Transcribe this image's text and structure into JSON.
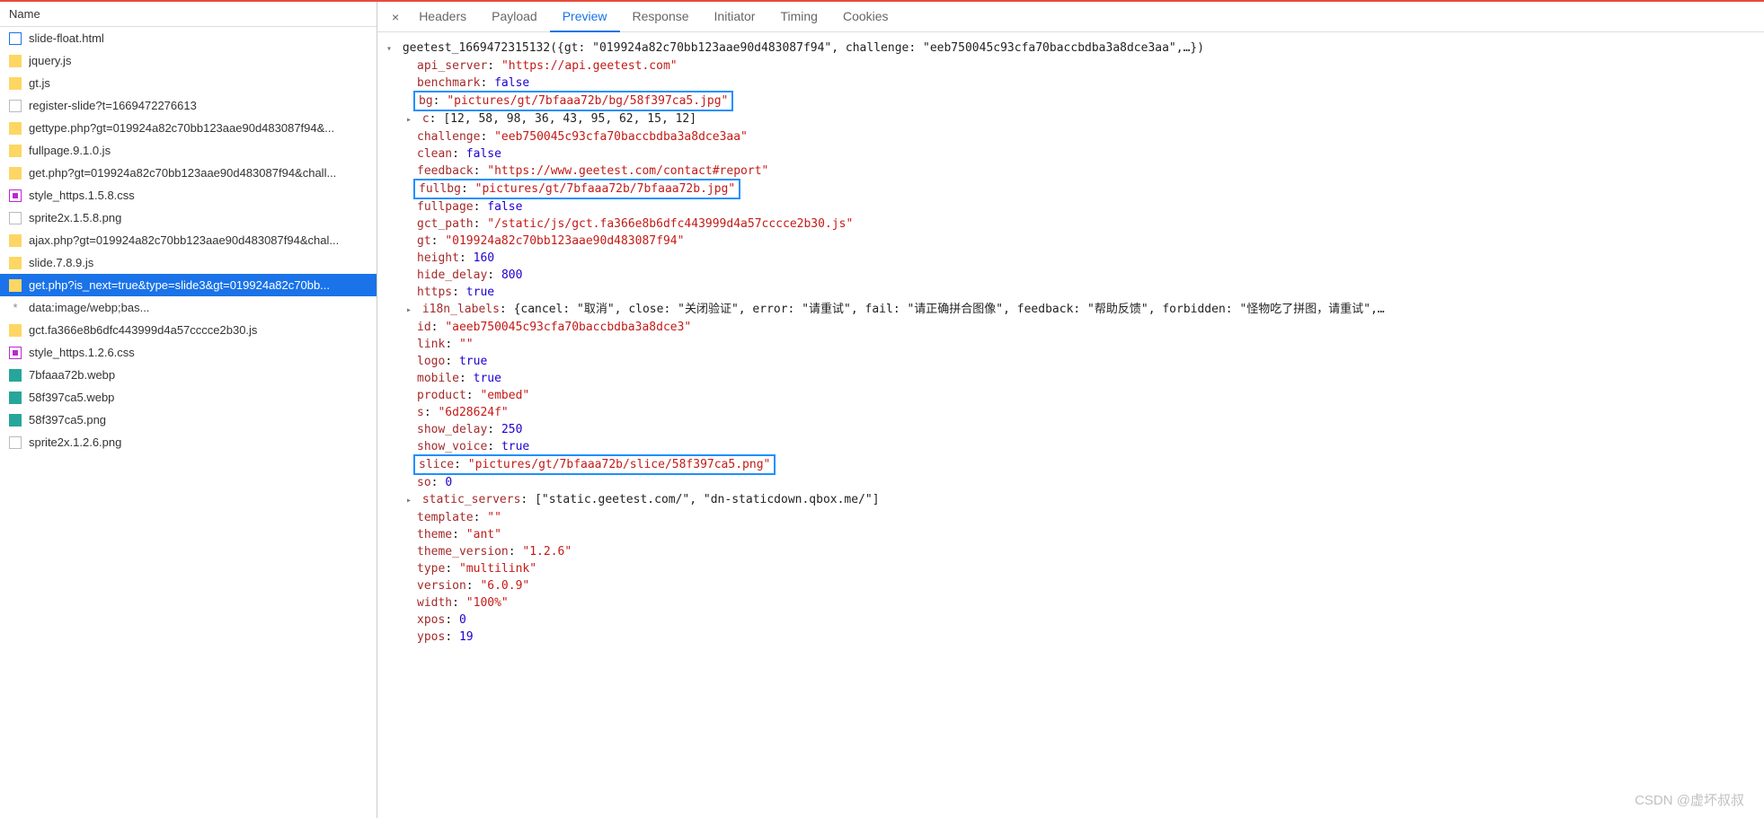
{
  "left_header": "Name",
  "files": [
    {
      "icon": "html",
      "label": "slide-float.html"
    },
    {
      "icon": "js",
      "label": "jquery.js"
    },
    {
      "icon": "js",
      "label": "gt.js"
    },
    {
      "icon": "blank",
      "label": "register-slide?t=1669472276613"
    },
    {
      "icon": "js",
      "label": "gettype.php?gt=019924a82c70bb123aae90d483087f94&..."
    },
    {
      "icon": "js",
      "label": "fullpage.9.1.0.js"
    },
    {
      "icon": "js",
      "label": "get.php?gt=019924a82c70bb123aae90d483087f94&chall..."
    },
    {
      "icon": "css",
      "label": "style_https.1.5.8.css"
    },
    {
      "icon": "blank",
      "label": "sprite2x.1.5.8.png"
    },
    {
      "icon": "js",
      "label": "ajax.php?gt=019924a82c70bb123aae90d483087f94&chal..."
    },
    {
      "icon": "js",
      "label": "slide.7.8.9.js"
    },
    {
      "icon": "js",
      "label": "get.php?is_next=true&type=slide3&gt=019924a82c70bb...",
      "selected": true
    },
    {
      "icon": "data",
      "label": "data:image/webp;bas..."
    },
    {
      "icon": "js",
      "label": "gct.fa366e8b6dfc443999d4a57cccce2b30.js"
    },
    {
      "icon": "css",
      "label": "style_https.1.2.6.css"
    },
    {
      "icon": "img",
      "label": "7bfaaa72b.webp"
    },
    {
      "icon": "img",
      "label": "58f397ca5.webp"
    },
    {
      "icon": "img",
      "label": "58f397ca5.png"
    },
    {
      "icon": "blank",
      "label": "sprite2x.1.2.6.png"
    }
  ],
  "tabs": [
    "Headers",
    "Payload",
    "Preview",
    "Response",
    "Initiator",
    "Timing",
    "Cookies"
  ],
  "active_tab": 2,
  "response": {
    "callback_line_prefix": "geetest_1669472315132(",
    "callback_obj_summary": "{gt: \"019924a82c70bb123aae90d483087f94\", challenge: \"eeb750045c93cfa70baccbdba3a8dce3aa\",…})",
    "props": [
      {
        "key": "api_server",
        "type": "str",
        "val": "\"https://api.geetest.com\""
      },
      {
        "key": "benchmark",
        "type": "bool",
        "val": "false"
      },
      {
        "key": "bg",
        "type": "str",
        "val": "\"pictures/gt/7bfaaa72b/bg/58f397ca5.jpg\"",
        "hl": true
      },
      {
        "key": "c",
        "type": "arr",
        "val": "[12, 58, 98, 36, 43, 95, 62, 15, 12]",
        "expandable": true
      },
      {
        "key": "challenge",
        "type": "str",
        "val": "\"eeb750045c93cfa70baccbdba3a8dce3aa\""
      },
      {
        "key": "clean",
        "type": "bool",
        "val": "false"
      },
      {
        "key": "feedback",
        "type": "str",
        "val": "\"https://www.geetest.com/contact#report\""
      },
      {
        "key": "fullbg",
        "type": "str",
        "val": "\"pictures/gt/7bfaaa72b/7bfaaa72b.jpg\"",
        "hl": true
      },
      {
        "key": "fullpage",
        "type": "bool",
        "val": "false"
      },
      {
        "key": "gct_path",
        "type": "str",
        "val": "\"/static/js/gct.fa366e8b6dfc443999d4a57cccce2b30.js\""
      },
      {
        "key": "gt",
        "type": "str",
        "val": "\"019924a82c70bb123aae90d483087f94\""
      },
      {
        "key": "height",
        "type": "num",
        "val": "160"
      },
      {
        "key": "hide_delay",
        "type": "num",
        "val": "800"
      },
      {
        "key": "https",
        "type": "bool",
        "val": "true"
      },
      {
        "key": "i18n_labels",
        "type": "obj",
        "val": "{cancel: \"取消\", close: \"关闭验证\", error: \"请重试\", fail: \"请正确拼合图像\", feedback: \"帮助反馈\", forbidden: \"怪物吃了拼图，请重试\",…",
        "expandable": true
      },
      {
        "key": "id",
        "type": "str",
        "val": "\"aeeb750045c93cfa70baccbdba3a8dce3\""
      },
      {
        "key": "link",
        "type": "str",
        "val": "\"\""
      },
      {
        "key": "logo",
        "type": "bool",
        "val": "true"
      },
      {
        "key": "mobile",
        "type": "bool",
        "val": "true"
      },
      {
        "key": "product",
        "type": "str",
        "val": "\"embed\""
      },
      {
        "key": "s",
        "type": "str",
        "val": "\"6d28624f\""
      },
      {
        "key": "show_delay",
        "type": "num",
        "val": "250"
      },
      {
        "key": "show_voice",
        "type": "bool",
        "val": "true"
      },
      {
        "key": "slice",
        "type": "str",
        "val": "\"pictures/gt/7bfaaa72b/slice/58f397ca5.png\"",
        "hl": true
      },
      {
        "key": "so",
        "type": "num",
        "val": "0"
      },
      {
        "key": "static_servers",
        "type": "arr",
        "val": "[\"static.geetest.com/\", \"dn-staticdown.qbox.me/\"]",
        "expandable": true
      },
      {
        "key": "template",
        "type": "str",
        "val": "\"\""
      },
      {
        "key": "theme",
        "type": "str",
        "val": "\"ant\""
      },
      {
        "key": "theme_version",
        "type": "str",
        "val": "\"1.2.6\""
      },
      {
        "key": "type",
        "type": "str",
        "val": "\"multilink\""
      },
      {
        "key": "version",
        "type": "str",
        "val": "\"6.0.9\""
      },
      {
        "key": "width",
        "type": "str",
        "val": "\"100%\""
      },
      {
        "key": "xpos",
        "type": "num",
        "val": "0"
      },
      {
        "key": "ypos",
        "type": "num",
        "val": "19"
      }
    ]
  },
  "watermark": "CSDN @虚坏叔叔"
}
